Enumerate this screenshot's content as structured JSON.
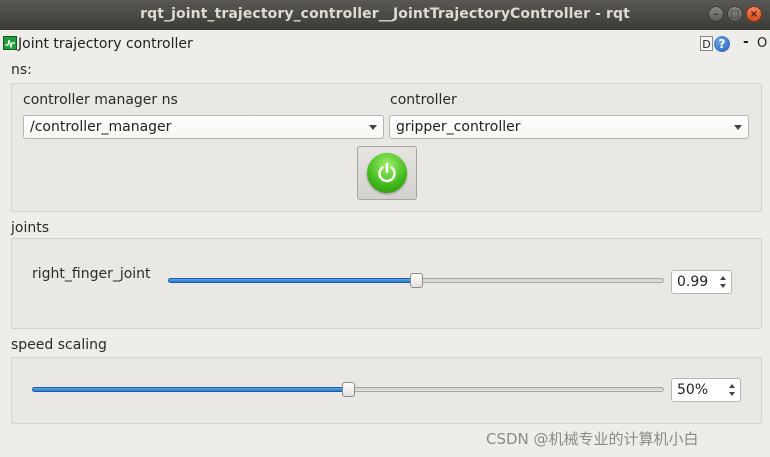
{
  "window": {
    "title": "rqt_joint_trajectory_controller__JointTrajectoryController - rqt",
    "buttons": [
      "minimize",
      "maximize",
      "close"
    ]
  },
  "plugin": {
    "title": "Joint trajectory controller",
    "dock_label": "D",
    "help_label": "?",
    "minimize_label": "-",
    "close_label": "O"
  },
  "ns": {
    "label": "ns:",
    "controller_manager_label": "controller manager ns",
    "controller_manager_value": "/controller_manager",
    "controller_label": "controller",
    "controller_value": "gripper_controller",
    "power_state": "on"
  },
  "joints": {
    "label": "joints",
    "items": [
      {
        "name": "right_finger_joint",
        "value": "0.99",
        "slider_fraction": 0.5
      }
    ]
  },
  "speed": {
    "label": "speed scaling",
    "value": "50%",
    "slider_fraction": 0.5
  },
  "watermark": "CSDN @机械专业的计算机小白",
  "colors": {
    "accent": "#2d78c8",
    "power": "#3fb81a",
    "titlebar": "#3c3b37"
  }
}
